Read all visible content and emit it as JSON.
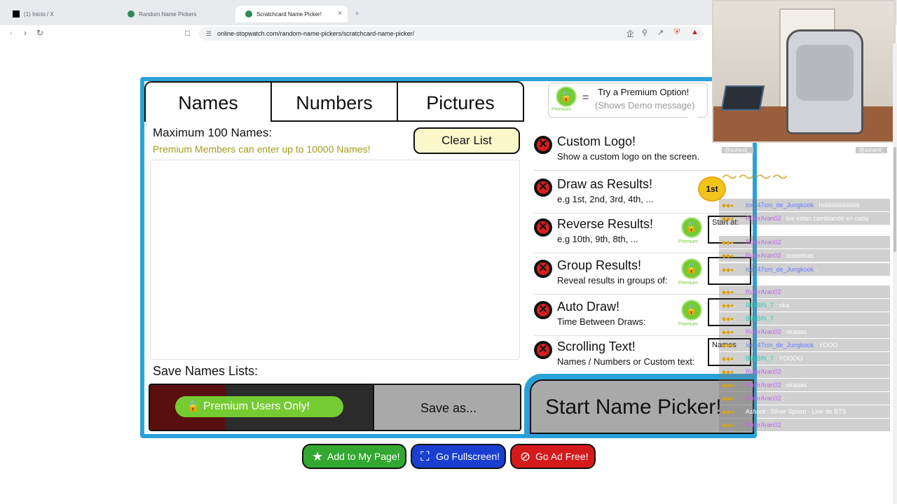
{
  "browser": {
    "tabs": [
      {
        "title": "(1) Inicio / X"
      },
      {
        "title": "Random Name Pickers"
      },
      {
        "title": "Scratchcard Name Picker!"
      }
    ],
    "url": "online-stopwatch.com/random-name-pickers/scratchcard-name-picker/",
    "new_tab": "+",
    "close_tab": "×"
  },
  "picker": {
    "tabs": [
      "Names",
      "Numbers",
      "Pictures"
    ],
    "max_names": "Maximum 100 Names:",
    "premium_note": "Premium Members can enter  up to 10000 Names!",
    "clear_list": "Clear List",
    "save_label": "Save Names Lists:",
    "premium_only": "Premium Users Only!",
    "save_as": "Save as...",
    "start": "Start Name Picker!"
  },
  "promo": {
    "equals": "=",
    "title": "Try a Premium Option!",
    "subtitle": "(Shows Demo message)",
    "lock_label": "Premium"
  },
  "options": [
    {
      "title": "Custom Logo!",
      "subtitle": "Show a custom logo on the screen."
    },
    {
      "title": "Draw as Results!",
      "subtitle": "e.g 1st, 2nd, 3rd, 4th, ..."
    },
    {
      "title": "Reverse Results!",
      "subtitle": "e.g 10th, 9th, 8th, ...",
      "box": "Start at:"
    },
    {
      "title": "Group Results!",
      "subtitle": "Reveal results in groups of:"
    },
    {
      "title": "Auto Draw!",
      "subtitle": "Time Between Draws:"
    },
    {
      "title": "Scrolling Text!",
      "subtitle": "Names / Numbers or Custom text:",
      "box": "Names"
    }
  ],
  "bottom": {
    "add": "Add to My Page!",
    "fullscreen": "Go Fullscreen!",
    "adfree": "Go Ad Free!"
  },
  "chat": {
    "header_left": "@asherit_",
    "header_right": "@asherit_",
    "messages": [
      {
        "user": "los_47cm_de_Jungkook",
        "text": "holiiiiiiiiiiiiiiiiiiiiiii",
        "color": "#6a7bff"
      },
      {
        "user": "RulerAran02",
        "text": "los estan cambiando en cada",
        "color": "#c06af0"
      },
      {
        "user": "RulerAran02",
        "text": "",
        "color": "#c06af0"
      },
      {
        "user": "RulerAran02",
        "text": "bueeenas",
        "color": "#c06af0"
      },
      {
        "user": "los_47cm_de_Jungkook",
        "text": "",
        "color": "#6a7bff"
      },
      {
        "user": "RulerAran02",
        "text": "",
        "color": "#c06af0"
      },
      {
        "user": "BINBIN_7",
        "text": "oka",
        "color": "#30d0b0"
      },
      {
        "user": "BINBIN_7",
        "text": "",
        "color": "#30d0b0"
      },
      {
        "user": "RulerAran02",
        "text": "okaaas",
        "color": "#c06af0"
      },
      {
        "user": "los_47cm_de_Jungkook",
        "text": "YOOO",
        "color": "#6a7bff"
      },
      {
        "user": "BINBIN_7",
        "text": "YOOOO",
        "color": "#30d0b0"
      },
      {
        "user": "RulerAran02",
        "text": "",
        "color": "#c06af0"
      },
      {
        "user": "RulerAran02",
        "text": "okaaas",
        "color": "#c06af0"
      },
      {
        "user": "RulerAran02",
        "text": "",
        "color": "#c06af0"
      },
      {
        "user": "Asherit",
        "text": "Silver Spoon - Live de BTS",
        "color": "#ffffff"
      },
      {
        "user": "RulerAran02",
        "text": "",
        "color": "#c06af0"
      }
    ]
  },
  "medal_text": "1st",
  "colors": {
    "widget_blue": "#2ba1d9",
    "premium_green": "#74cc32",
    "x_red": "#d71e1e"
  }
}
